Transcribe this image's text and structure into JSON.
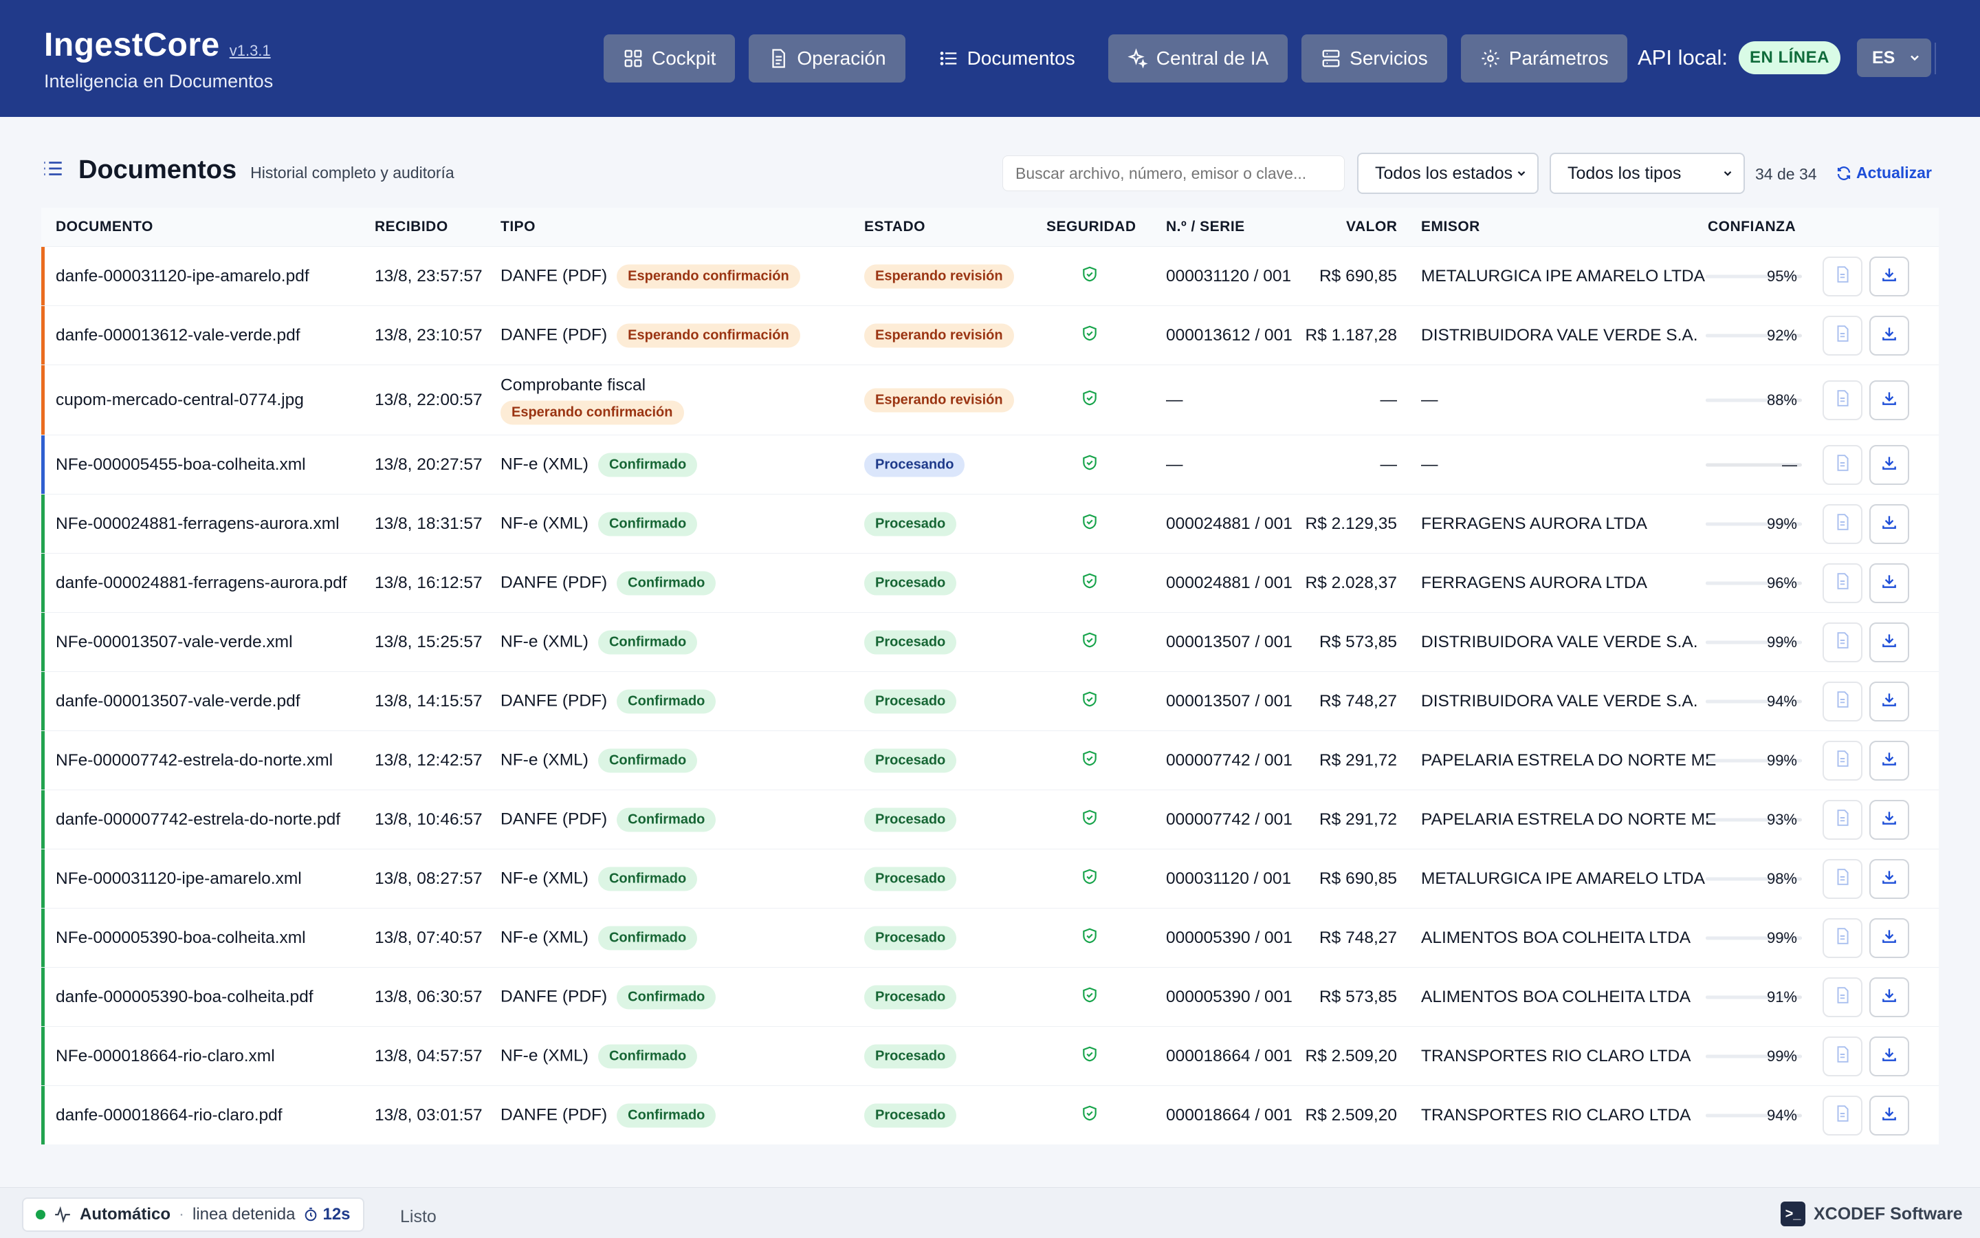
{
  "app": {
    "name": "IngestCore",
    "version": "v1.3.1",
    "tagline": "Inteligencia en Documentos"
  },
  "nav": [
    {
      "label": "Cockpit",
      "icon": "grid-icon",
      "active": false
    },
    {
      "label": "Operación",
      "icon": "document-icon",
      "active": false
    },
    {
      "label": "Documentos",
      "icon": "list-icon",
      "active": true
    },
    {
      "label": "Central de IA",
      "icon": "sparkle-icon",
      "active": false
    },
    {
      "label": "Servicios",
      "icon": "server-icon",
      "active": false
    },
    {
      "label": "Parámetros",
      "icon": "gear-icon",
      "active": false
    }
  ],
  "api": {
    "label": "API local:",
    "status": "EN LÍNEA",
    "status_color": "#0f6b3a"
  },
  "language": {
    "value": "ES"
  },
  "panel": {
    "title": "Documentos",
    "subtitle": "Historial completo y auditoría",
    "search_placeholder": "Buscar archivo, número, emisor o clave...",
    "status_filter": "Todos los estados",
    "type_filter": "Todos los tipos",
    "count": "34 de 34",
    "refresh_label": "Actualizar"
  },
  "columns": {
    "document": "DOCUMENTO",
    "received": "RECIBIDO",
    "type": "TIPO",
    "state": "ESTADO",
    "security": "SEGURIDAD",
    "number": "N.º / SERIE",
    "value": "VALOR",
    "issuer": "EMISOR",
    "confidence": "CONFIANZA"
  },
  "colors": {
    "accent_pending": "#ea6c1f",
    "accent_processing": "#2f5fd0",
    "accent_done": "#22a34f",
    "header_bg": "#213a8a"
  },
  "rows": [
    {
      "file": "danfe-000031120-ipe-amarelo.pdf",
      "received": "13/8, 23:57:57",
      "type": "DANFE (PDF)",
      "confirm": "Esperando confirmación",
      "state": "Esperando revisión",
      "number": "000031120 / 001",
      "value": "R$ 690,85",
      "issuer": "METALURGICA IPE AMARELO LTDA",
      "confidence": "95%",
      "accent": "pending"
    },
    {
      "file": "danfe-000013612-vale-verde.pdf",
      "received": "13/8, 23:10:57",
      "type": "DANFE (PDF)",
      "confirm": "Esperando confirmación",
      "state": "Esperando revisión",
      "number": "000013612 / 001",
      "value": "R$ 1.187,28",
      "issuer": "DISTRIBUIDORA VALE VERDE S.A.",
      "confidence": "92%",
      "accent": "pending"
    },
    {
      "file": "cupom-mercado-central-0774.jpg",
      "received": "13/8, 22:00:57",
      "type": "Comprobante fiscal",
      "confirm": "Esperando confirmación",
      "state": "Esperando revisión",
      "number": "—",
      "value": "—",
      "issuer": "—",
      "confidence": "88%",
      "accent": "pending",
      "stacked": true
    },
    {
      "file": "NFe-000005455-boa-colheita.xml",
      "received": "13/8, 20:27:57",
      "type": "NF-e (XML)",
      "confirm": "Confirmado",
      "state": "Procesando",
      "number": "—",
      "value": "—",
      "issuer": "—",
      "confidence": "—",
      "accent": "processing"
    },
    {
      "file": "NFe-000024881-ferragens-aurora.xml",
      "received": "13/8, 18:31:57",
      "type": "NF-e (XML)",
      "confirm": "Confirmado",
      "state": "Procesado",
      "number": "000024881 / 001",
      "value": "R$ 2.129,35",
      "issuer": "FERRAGENS AURORA LTDA",
      "confidence": "99%",
      "accent": "done"
    },
    {
      "file": "danfe-000024881-ferragens-aurora.pdf",
      "received": "13/8, 16:12:57",
      "type": "DANFE (PDF)",
      "confirm": "Confirmado",
      "state": "Procesado",
      "number": "000024881 / 001",
      "value": "R$ 2.028,37",
      "issuer": "FERRAGENS AURORA LTDA",
      "confidence": "96%",
      "accent": "done"
    },
    {
      "file": "NFe-000013507-vale-verde.xml",
      "received": "13/8, 15:25:57",
      "type": "NF-e (XML)",
      "confirm": "Confirmado",
      "state": "Procesado",
      "number": "000013507 / 001",
      "value": "R$ 573,85",
      "issuer": "DISTRIBUIDORA VALE VERDE S.A.",
      "confidence": "99%",
      "accent": "done"
    },
    {
      "file": "danfe-000013507-vale-verde.pdf",
      "received": "13/8, 14:15:57",
      "type": "DANFE (PDF)",
      "confirm": "Confirmado",
      "state": "Procesado",
      "number": "000013507 / 001",
      "value": "R$ 748,27",
      "issuer": "DISTRIBUIDORA VALE VERDE S.A.",
      "confidence": "94%",
      "accent": "done"
    },
    {
      "file": "NFe-000007742-estrela-do-norte.xml",
      "received": "13/8, 12:42:57",
      "type": "NF-e (XML)",
      "confirm": "Confirmado",
      "state": "Procesado",
      "number": "000007742 / 001",
      "value": "R$ 291,72",
      "issuer": "PAPELARIA ESTRELA DO NORTE ME",
      "confidence": "99%",
      "accent": "done"
    },
    {
      "file": "danfe-000007742-estrela-do-norte.pdf",
      "received": "13/8, 10:46:57",
      "type": "DANFE (PDF)",
      "confirm": "Confirmado",
      "state": "Procesado",
      "number": "000007742 / 001",
      "value": "R$ 291,72",
      "issuer": "PAPELARIA ESTRELA DO NORTE ME",
      "confidence": "93%",
      "accent": "done"
    },
    {
      "file": "NFe-000031120-ipe-amarelo.xml",
      "received": "13/8, 08:27:57",
      "type": "NF-e (XML)",
      "confirm": "Confirmado",
      "state": "Procesado",
      "number": "000031120 / 001",
      "value": "R$ 690,85",
      "issuer": "METALURGICA IPE AMARELO LTDA",
      "confidence": "98%",
      "accent": "done"
    },
    {
      "file": "NFe-000005390-boa-colheita.xml",
      "received": "13/8, 07:40:57",
      "type": "NF-e (XML)",
      "confirm": "Confirmado",
      "state": "Procesado",
      "number": "000005390 / 001",
      "value": "R$ 748,27",
      "issuer": "ALIMENTOS BOA COLHEITA LTDA",
      "confidence": "99%",
      "accent": "done"
    },
    {
      "file": "danfe-000005390-boa-colheita.pdf",
      "received": "13/8, 06:30:57",
      "type": "DANFE (PDF)",
      "confirm": "Confirmado",
      "state": "Procesado",
      "number": "000005390 / 001",
      "value": "R$ 573,85",
      "issuer": "ALIMENTOS BOA COLHEITA LTDA",
      "confidence": "91%",
      "accent": "done"
    },
    {
      "file": "NFe-000018664-rio-claro.xml",
      "received": "13/8, 04:57:57",
      "type": "NF-e (XML)",
      "confirm": "Confirmado",
      "state": "Procesado",
      "number": "000018664 / 001",
      "value": "R$ 2.509,20",
      "issuer": "TRANSPORTES RIO CLARO LTDA",
      "confidence": "99%",
      "accent": "done"
    },
    {
      "file": "danfe-000018664-rio-claro.pdf",
      "received": "13/8, 03:01:57",
      "type": "DANFE (PDF)",
      "confirm": "Confirmado",
      "state": "Procesado",
      "number": "000018664 / 001",
      "value": "R$ 2.509,20",
      "issuer": "TRANSPORTES RIO CLARO LTDA",
      "confidence": "94%",
      "accent": "done"
    }
  ],
  "footer": {
    "mode": "Automático",
    "separator": "·",
    "loop_state": "linea detenida",
    "timer": "12s",
    "status": "Listo",
    "vendor": "XCODEF Software"
  }
}
